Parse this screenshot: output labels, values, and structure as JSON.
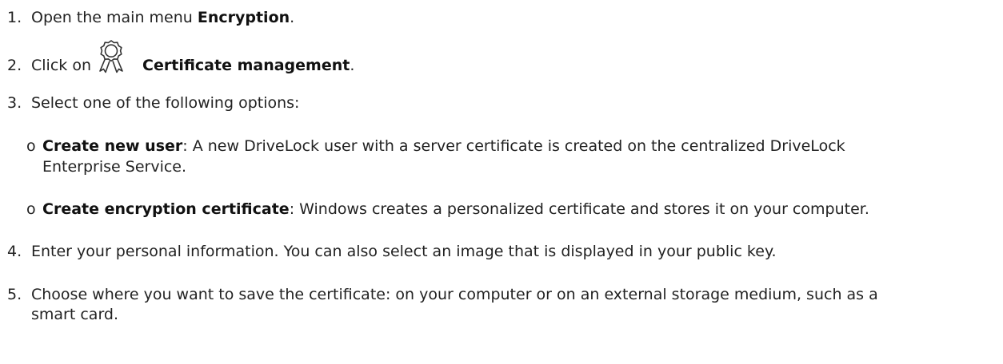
{
  "steps": [
    {
      "num": "1.",
      "pre": "Open the main menu ",
      "bold": "Encryption",
      "post": "."
    },
    {
      "num": "2.",
      "pre": "Click on ",
      "bold": "Certificate management",
      "post": ".",
      "icon": "certificate-badge-icon"
    },
    {
      "num": "3.",
      "text": "Select one of the following options:"
    },
    {
      "num": "4.",
      "text": "Enter your personal information. You can also select an image that is displayed in your public key."
    },
    {
      "num": "5.",
      "line1": "Choose where you want to save the certificate: on your computer or on an external storage medium, such as a",
      "line2": "smart card."
    }
  ],
  "options": [
    {
      "bullet": "o",
      "bold": "Create new user",
      "line1": ": A new DriveLock user with a server certificate is created on the centralized DriveLock",
      "line2": "Enterprise Service."
    },
    {
      "bullet": "o",
      "bold": "Create encryption certificate",
      "line1": ": Windows creates a personalized certificate and stores it on your computer."
    }
  ]
}
